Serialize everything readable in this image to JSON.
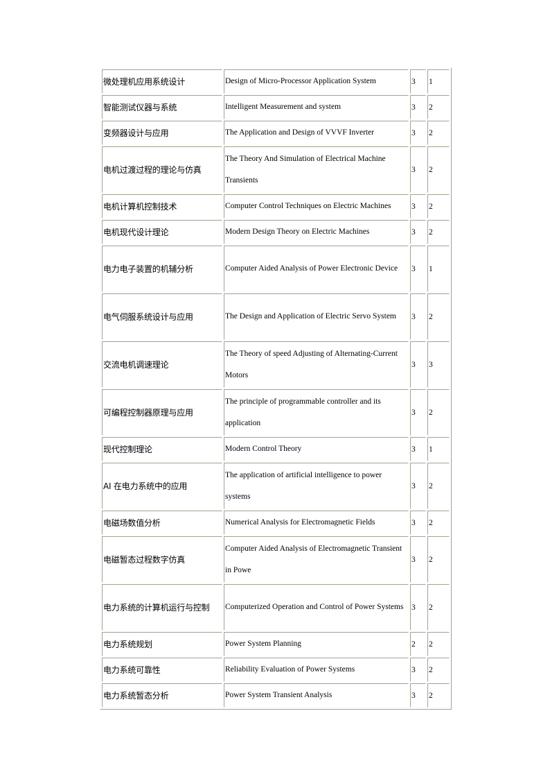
{
  "table": {
    "rows": [
      {
        "cn": "微处理机应用系统设计",
        "en": "Design of Micro-Processor Application System",
        "a": "3",
        "b": "1",
        "lines": 1
      },
      {
        "cn": "智能测试仪器与系统",
        "en": "Intelligent Measurement and system",
        "a": "3",
        "b": "2",
        "lines": 1
      },
      {
        "cn": "变频器设计与应用",
        "en": "The Application and Design of VVVF Inverter",
        "a": "3",
        "b": "2",
        "lines": 1
      },
      {
        "cn": "电机过渡过程的理论与仿真",
        "en": "The Theory And Simulation of Electrical Machine Transients",
        "a": "3",
        "b": "2",
        "lines": 2
      },
      {
        "cn": "电机计算机控制技术",
        "en": "Computer Control Techniques on Electric Machines",
        "a": "3",
        "b": "2",
        "lines": 1
      },
      {
        "cn": "电机现代设计理论",
        "en": "Modern Design Theory on Electric Machines",
        "a": "3",
        "b": "2",
        "lines": 1
      },
      {
        "cn": "电力电子装置的机辅分析",
        "en": "Computer Aided Analysis of Power Electronic Device",
        "a": "3",
        "b": "1",
        "lines": 2
      },
      {
        "cn": "电气伺服系统设计与应用",
        "en": "The Design and Application of Electric Servo System",
        "a": "3",
        "b": "2",
        "lines": 2
      },
      {
        "cn": "交流电机调速理论",
        "en": "The Theory of speed Adjusting of Alternating-Current Motors",
        "a": "3",
        "b": "3",
        "lines": 2
      },
      {
        "cn": "可编程控制器原理与应用",
        "en": "The principle of programmable controller and its application",
        "a": "3",
        "b": "2",
        "lines": 2
      },
      {
        "cn": "现代控制理论",
        "en": "Modern Control Theory",
        "a": "3",
        "b": "1",
        "lines": 1
      },
      {
        "cn": "AI 在电力系统中的应用",
        "en": "The application of artificial intelligence to power systems",
        "a": "3",
        "b": "2",
        "lines": 2
      },
      {
        "cn": "电磁场数值分析",
        "en": "Numerical Analysis for Electromagnetic Fields",
        "a": "3",
        "b": "2",
        "lines": 1
      },
      {
        "cn": "电磁暂态过程数字仿真",
        "en": "Computer Aided Analysis of Electromagnetic Transient in Powe",
        "a": "3",
        "b": "2",
        "lines": 2
      },
      {
        "cn": "电力系统的计算机运行与控制",
        "en": "Computerized Operation and Control of Power Systems",
        "a": "3",
        "b": "2",
        "lines": 2
      },
      {
        "cn": "电力系统规划",
        "en": "Power System Planning",
        "a": "2",
        "b": "2",
        "lines": 1
      },
      {
        "cn": "电力系统可靠性",
        "en": "Reliability Evaluation of Power Systems",
        "a": "3",
        "b": "2",
        "lines": 1
      },
      {
        "cn": "电力系统暂态分析",
        "en": "Power System Transient Analysis",
        "a": "3",
        "b": "2",
        "lines": 1
      }
    ]
  }
}
